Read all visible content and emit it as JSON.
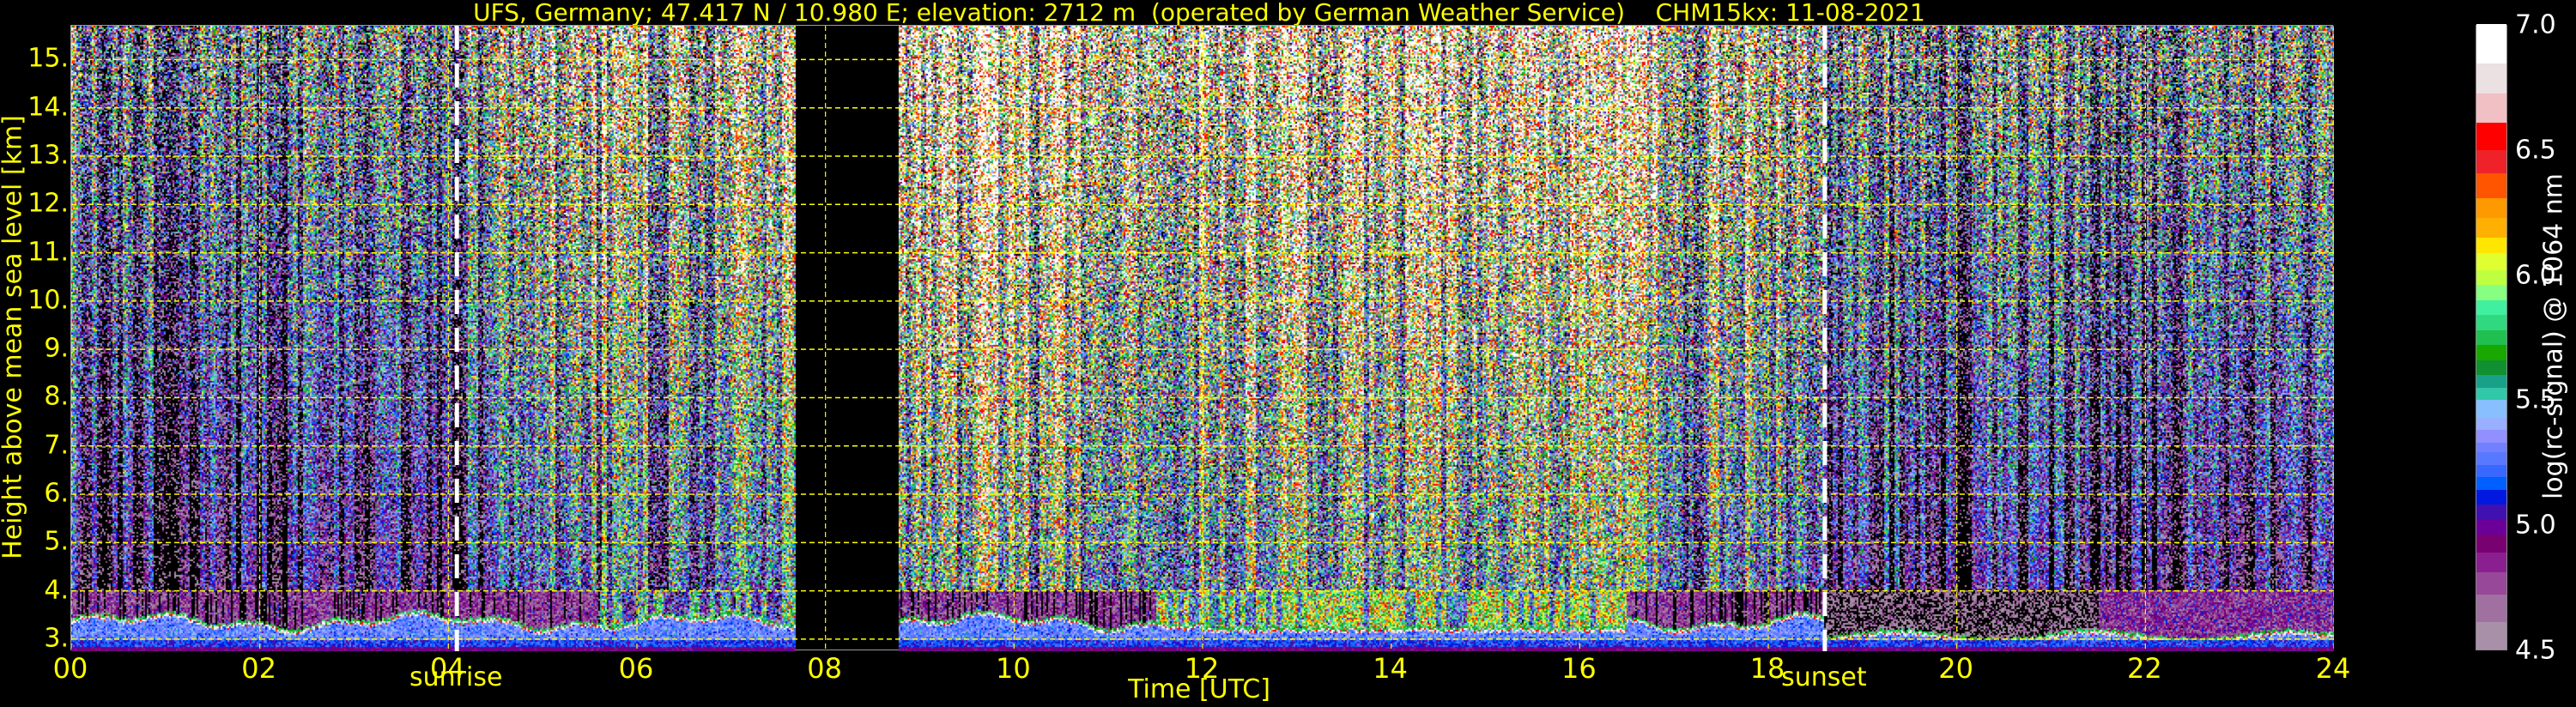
{
  "chart_data": {
    "type": "heatmap",
    "title": "UFS, Germany; 47.417 N / 10.980 E; elevation: 2712 m  (operated by German Weather Service)    CHM15kx: 11-08-2021",
    "xlabel": "Time [UTC]",
    "ylabel": "Height above mean sea level [km]",
    "xlim": [
      0,
      24
    ],
    "ylim": [
      2.75,
      15.7
    ],
    "x_ticks": [
      0,
      2,
      4,
      6,
      8,
      10,
      12,
      14,
      16,
      18,
      20,
      22,
      24
    ],
    "x_tick_labels": [
      "00",
      "02",
      "04",
      "06",
      "08",
      "10",
      "12",
      "14",
      "16",
      "18",
      "20",
      "22",
      "24"
    ],
    "y_ticks": [
      3,
      4,
      5,
      6,
      7,
      8,
      9,
      10,
      11,
      12,
      13,
      14,
      15
    ],
    "y_tick_labels": [
      "3.",
      "4.",
      "5.",
      "6.",
      "7.",
      "8.",
      "9.",
      "10.",
      "11.",
      "12.",
      "13.",
      "14.",
      "15."
    ],
    "grid": true,
    "data_gap_hours": [
      7.68,
      8.77
    ],
    "events": [
      {
        "label": "sunrise",
        "time": 4.09
      },
      {
        "label": "sunset",
        "time": 18.6
      }
    ],
    "colorbar": {
      "label": "log(rc-signal) @ 1064 nm",
      "range": [
        4.5,
        7.0
      ],
      "ticks": [
        4.5,
        5.0,
        5.5,
        6.0,
        6.5,
        7.0
      ],
      "tick_labels": [
        "4.5",
        "5.0",
        "5.5",
        "6.0",
        "6.5",
        "7.0"
      ],
      "levels": [
        4.5,
        4.61,
        4.72,
        4.81,
        4.89,
        4.96,
        5.02,
        5.08,
        5.14,
        5.19,
        5.24,
        5.29,
        5.33,
        5.38,
        5.43,
        5.5,
        5.55,
        5.6,
        5.66,
        5.72,
        5.78,
        5.84,
        5.9,
        5.96,
        6.02,
        6.09,
        6.15,
        6.23,
        6.31,
        6.41,
        6.5,
        6.61,
        6.73,
        6.85,
        7.0
      ],
      "colors": [
        "#a890a8",
        "#a070a0",
        "#984898",
        "#8a2090",
        "#780070",
        "#6a0098",
        "#4010b0",
        "#0018e0",
        "#0060ff",
        "#3868ff",
        "#5878ff",
        "#7080ff",
        "#9090ff",
        "#98b0ff",
        "#88c0ff",
        "#30c8a8",
        "#18a088",
        "#109030",
        "#18a800",
        "#20c050",
        "#30d880",
        "#40f0a0",
        "#88ff80",
        "#c0ff40",
        "#e0ff30",
        "#ffe600",
        "#ffb000",
        "#ff9900",
        "#ff5500",
        "#ee2228",
        "#ff0000",
        "#f0c0c4",
        "#ebe0e2",
        "#ffffff"
      ]
    },
    "boundary_layer_top_km_approx": 3.4,
    "colors": {
      "text": "#ffff00",
      "grid": "#ffff00",
      "event_line": "#ffffff",
      "background": "#000000"
    }
  }
}
